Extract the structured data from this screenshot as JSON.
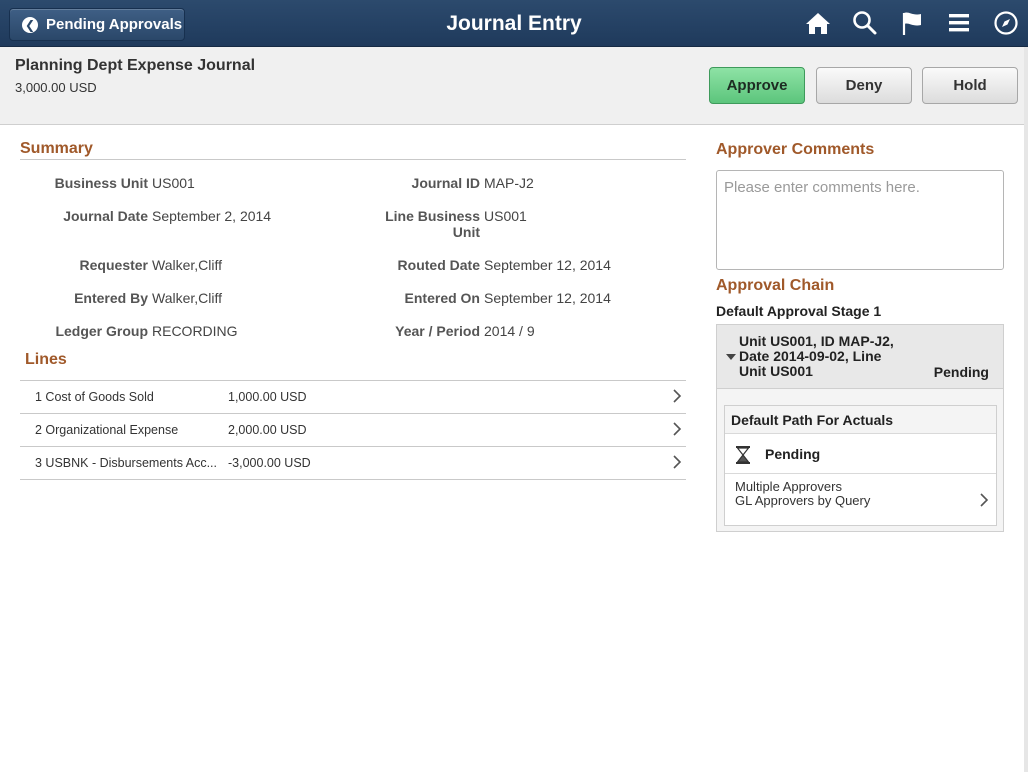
{
  "header": {
    "back_label": "Pending Approvals",
    "title": "Journal Entry",
    "icons": [
      "home-icon",
      "search-icon",
      "flag-icon",
      "menu-icon",
      "compass-icon"
    ]
  },
  "journal": {
    "name": "Planning Dept Expense Journal",
    "amount": "3,000.00 USD"
  },
  "actions": {
    "approve": "Approve",
    "deny": "Deny",
    "hold": "Hold"
  },
  "summary": {
    "heading": "Summary",
    "business_unit_label": "Business Unit",
    "business_unit_value": "US001",
    "journal_id_label": "Journal ID",
    "journal_id_value": "MAP-J2",
    "journal_date_label": "Journal Date",
    "journal_date_value": "September 2, 2014",
    "line_bu_label_1": "Line Business",
    "line_bu_label_2": "Unit",
    "line_bu_value": "US001",
    "requester_label": "Requester",
    "requester_value": "Walker,Cliff",
    "routed_date_label": "Routed Date",
    "routed_date_value": "September 12, 2014",
    "entered_by_label": "Entered By",
    "entered_by_value": "Walker,Cliff",
    "entered_on_label": "Entered On",
    "entered_on_value": "September 12, 2014",
    "ledger_group_label": "Ledger Group",
    "ledger_group_value": "RECORDING",
    "year_period_label": "Year / Period",
    "year_period_value": "2014 / 9"
  },
  "lines": {
    "heading": "Lines",
    "rows": [
      {
        "desc": "1 Cost of Goods Sold",
        "amount": "1,000.00 USD"
      },
      {
        "desc": "2 Organizational Expense",
        "amount": "2,000.00 USD"
      },
      {
        "desc": "3 USBNK - Disbursements Acc...",
        "amount": "-3,000.00 USD"
      }
    ]
  },
  "comments": {
    "heading": "Approver Comments",
    "placeholder": "Please enter comments here."
  },
  "chain": {
    "heading": "Approval Chain",
    "stage": "Default Approval Stage 1",
    "item_title": "Unit US001, ID MAP-J2, Date 2014-09-02, Line Unit US001",
    "item_status": "Pending",
    "path_title": "Default Path For Actuals",
    "path_status": "Pending",
    "approvers_line1": "Multiple Approvers",
    "approvers_line2": "GL Approvers by Query"
  },
  "colors": {
    "header_bg": "#1f3a5c",
    "accent_heading": "#a0592a",
    "approve_green": "#5cc57c"
  }
}
